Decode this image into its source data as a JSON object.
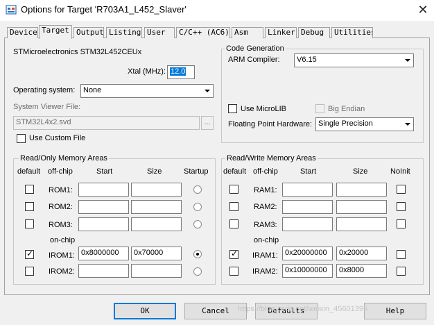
{
  "window": {
    "title": "Options for Target 'R703A1_L452_Slaver'",
    "close_label": "✕"
  },
  "tabs": [
    {
      "label": "Device"
    },
    {
      "label": "Target"
    },
    {
      "label": "Output"
    },
    {
      "label": "Listing"
    },
    {
      "label": "User"
    },
    {
      "label": "C/C++ (AC6)"
    },
    {
      "label": "Asm"
    },
    {
      "label": "Linker"
    },
    {
      "label": "Debug"
    },
    {
      "label": "Utilities"
    }
  ],
  "target": {
    "device_name": "STMicroelectronics STM32L452CEUx",
    "xtal_label": "Xtal (MHz):",
    "xtal_value": "12.0",
    "os_label": "Operating system:",
    "os_value": "None",
    "svf_label": "System Viewer File:",
    "svf_value": "STM32L4x2.svd",
    "browse_label": "...",
    "custom_file_label": "Use Custom File"
  },
  "code_gen": {
    "title": "Code Generation",
    "compiler_label": "ARM Compiler:",
    "compiler_value": "V6.15",
    "microlib_label": "Use MicroLIB",
    "big_endian_label": "Big Endian",
    "fpu_label": "Floating Point Hardware:",
    "fpu_value": "Single Precision"
  },
  "ro_mem": {
    "title": "Read/Only Memory Areas",
    "headers": {
      "default": "default",
      "offchip": "off-chip",
      "start": "Start",
      "size": "Size",
      "last": "Startup"
    },
    "onchip_label": "on-chip",
    "rows": [
      {
        "name": "ROM1:",
        "start": "",
        "size": ""
      },
      {
        "name": "ROM2:",
        "start": "",
        "size": ""
      },
      {
        "name": "ROM3:",
        "start": "",
        "size": ""
      },
      {
        "name": "IROM1:",
        "start": "0x8000000",
        "size": "0x70000"
      },
      {
        "name": "IROM2:",
        "start": "",
        "size": ""
      }
    ]
  },
  "rw_mem": {
    "title": "Read/Write Memory Areas",
    "headers": {
      "default": "default",
      "offchip": "off-chip",
      "start": "Start",
      "size": "Size",
      "last": "NoInit"
    },
    "onchip_label": "on-chip",
    "rows": [
      {
        "name": "RAM1:",
        "start": "",
        "size": ""
      },
      {
        "name": "RAM2:",
        "start": "",
        "size": ""
      },
      {
        "name": "RAM3:",
        "start": "",
        "size": ""
      },
      {
        "name": "IRAM1:",
        "start": "0x20000000",
        "size": "0x20000"
      },
      {
        "name": "IRAM2:",
        "start": "0x10000000",
        "size": "0x8000"
      }
    ]
  },
  "buttons": {
    "ok": "OK",
    "cancel": "Cancel",
    "defaults": "Defaults",
    "help": "Help"
  },
  "watermark": "https://blog.csdn.net/weixin_45601395",
  "colors": {
    "accent": "#0078d7",
    "window_bg": "#f0f0f0"
  }
}
